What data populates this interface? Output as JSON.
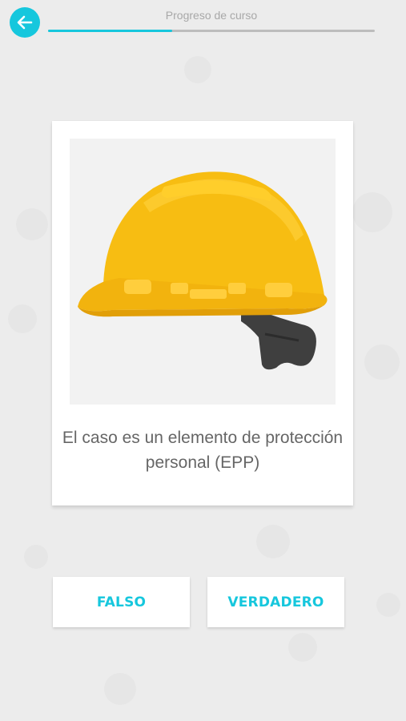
{
  "header": {
    "progress_label": "Progreso de curso",
    "progress_fraction": 0.38
  },
  "card": {
    "image_icon": "hard-hat",
    "question": "El caso es un elemento de protección personal (EPP)"
  },
  "answers": {
    "false_label": "FALSO",
    "true_label": "VERDADERO"
  },
  "colors": {
    "accent": "#16c7dd",
    "helmet": "#f7bd12",
    "background": "#ececec"
  }
}
